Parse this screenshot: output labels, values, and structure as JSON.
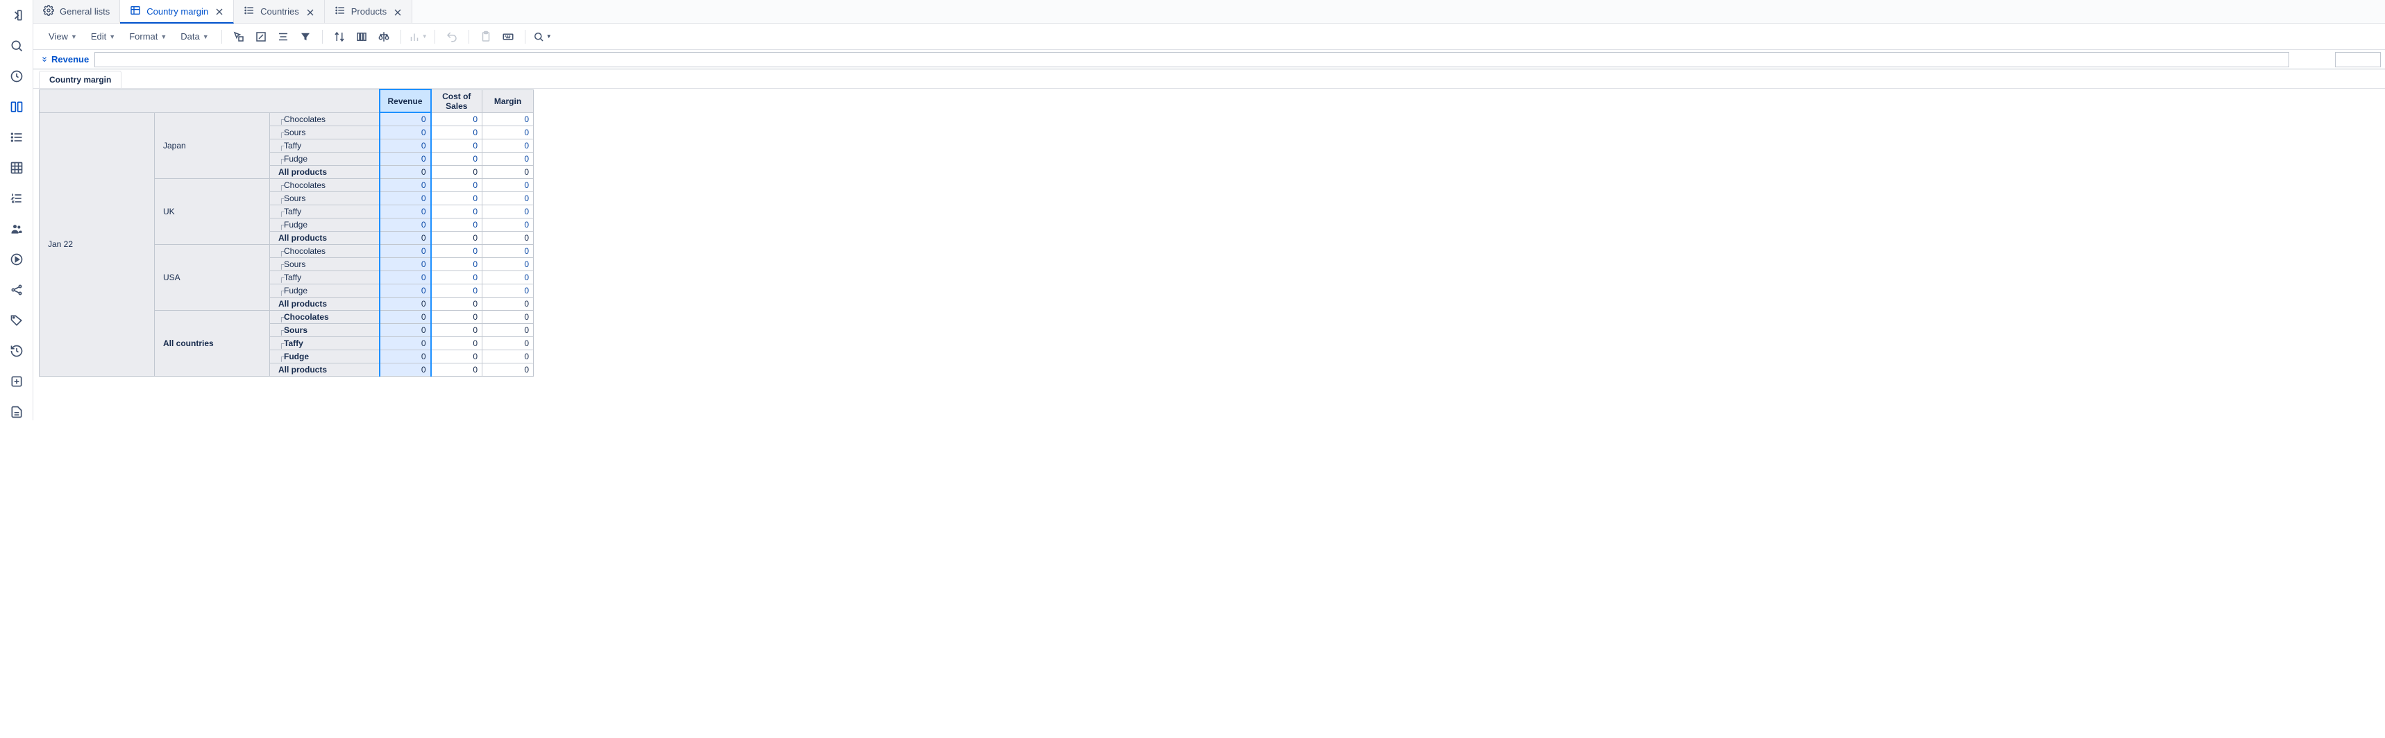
{
  "tabs": [
    {
      "label": "General lists",
      "icon": "gear"
    },
    {
      "label": "Country margin",
      "icon": "table",
      "active": true
    },
    {
      "label": "Countries",
      "icon": "list"
    },
    {
      "label": "Products",
      "icon": "list"
    }
  ],
  "toolbar": {
    "view": "View",
    "edit": "Edit",
    "format": "Format",
    "data": "Data"
  },
  "selection": {
    "label": "Revenue"
  },
  "sheet": {
    "name": "Country margin"
  },
  "grid": {
    "columns": [
      "Revenue",
      "Cost of Sales",
      "Margin"
    ],
    "selected_column_index": 0,
    "period": "Jan 22",
    "countries": [
      {
        "name": "Japan",
        "rows": [
          {
            "product": "Chocolates",
            "values": [
              "0",
              "0",
              "0"
            ],
            "link": true
          },
          {
            "product": "Sours",
            "values": [
              "0",
              "0",
              "0"
            ],
            "link": true
          },
          {
            "product": "Taffy",
            "values": [
              "0",
              "0",
              "0"
            ],
            "link": true
          },
          {
            "product": "Fudge",
            "values": [
              "0",
              "0",
              "0"
            ],
            "link": true
          },
          {
            "product": "All products",
            "values": [
              "0",
              "0",
              "0"
            ],
            "total": true
          }
        ]
      },
      {
        "name": "UK",
        "rows": [
          {
            "product": "Chocolates",
            "values": [
              "0",
              "0",
              "0"
            ],
            "link": true
          },
          {
            "product": "Sours",
            "values": [
              "0",
              "0",
              "0"
            ],
            "link": true
          },
          {
            "product": "Taffy",
            "values": [
              "0",
              "0",
              "0"
            ],
            "link": true
          },
          {
            "product": "Fudge",
            "values": [
              "0",
              "0",
              "0"
            ],
            "link": true
          },
          {
            "product": "All products",
            "values": [
              "0",
              "0",
              "0"
            ],
            "total": true
          }
        ]
      },
      {
        "name": "USA",
        "rows": [
          {
            "product": "Chocolates",
            "values": [
              "0",
              "0",
              "0"
            ],
            "link": true
          },
          {
            "product": "Sours",
            "values": [
              "0",
              "0",
              "0"
            ],
            "link": true
          },
          {
            "product": "Taffy",
            "values": [
              "0",
              "0",
              "0"
            ],
            "link": true
          },
          {
            "product": "Fudge",
            "values": [
              "0",
              "0",
              "0"
            ],
            "link": true
          },
          {
            "product": "All products",
            "values": [
              "0",
              "0",
              "0"
            ],
            "total": true
          }
        ]
      },
      {
        "name": "All countries",
        "bold": true,
        "rows": [
          {
            "product": "Chocolates",
            "values": [
              "0",
              "0",
              "0"
            ],
            "total": true,
            "treeline": true
          },
          {
            "product": "Sours",
            "values": [
              "0",
              "0",
              "0"
            ],
            "total": true,
            "treeline": true
          },
          {
            "product": "Taffy",
            "values": [
              "0",
              "0",
              "0"
            ],
            "total": true,
            "treeline": true
          },
          {
            "product": "Fudge",
            "values": [
              "0",
              "0",
              "0"
            ],
            "total": true,
            "treeline": true
          },
          {
            "product": "All products",
            "values": [
              "0",
              "0",
              "0"
            ],
            "total": true
          }
        ]
      }
    ]
  }
}
